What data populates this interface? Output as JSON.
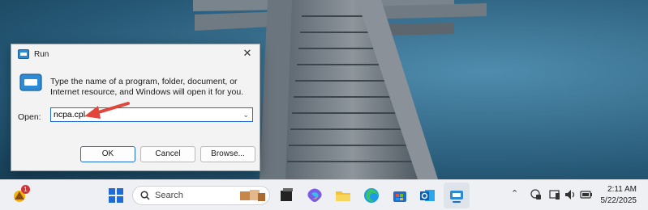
{
  "run_dialog": {
    "title": "Run",
    "description": "Type the name of a program, folder, document, or Internet resource, and Windows will open it for you.",
    "open_label": "Open:",
    "input_value": "ncpa.cpl",
    "ok_label": "OK",
    "cancel_label": "Cancel",
    "browse_label": "Browse..."
  },
  "taskbar": {
    "search_placeholder": "Search",
    "weather_badge": "1",
    "icons": [
      "weather-icon",
      "start-icon",
      "search-icon",
      "task-view-icon",
      "copilot-icon",
      "file-explorer-icon",
      "edge-icon",
      "store-icon",
      "outlook-icon",
      "remote-desktop-icon"
    ],
    "tray_icons": [
      "chevron-up-icon",
      "vpn-icon",
      "phone-link-icon",
      "volume-icon",
      "battery-icon"
    ],
    "clock_time": "2:11 AM",
    "clock_date": "5/22/2025"
  },
  "colors": {
    "accent": "#1e6bd6",
    "arrow": "#e2463a",
    "wallpaper": "#245673"
  }
}
